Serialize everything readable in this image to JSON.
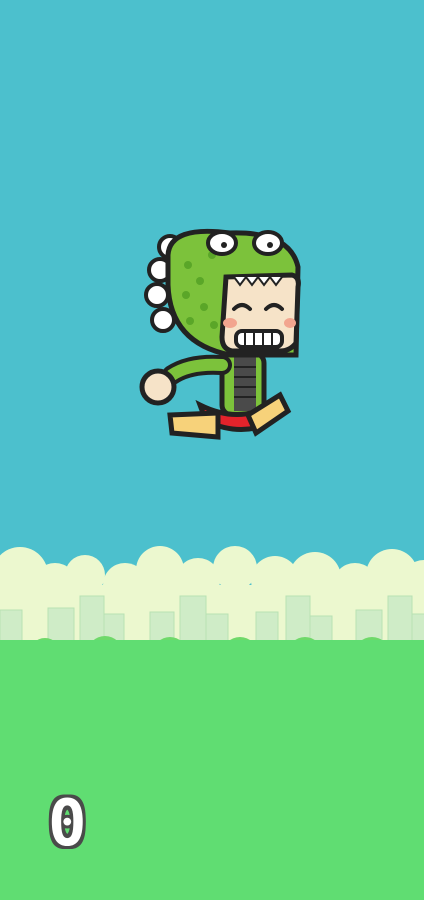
{
  "game": {
    "score": "0"
  },
  "colors": {
    "sky": "#4cc0cd",
    "clouds": "#ecf8cf",
    "city": "#cfecc7",
    "bushes": "#6fd96a",
    "ground": "#60dd72",
    "character_suit": "#7cc23b",
    "character_shorts": "#e3232b"
  },
  "icons": {
    "player": "dino-costume-kid-icon"
  }
}
